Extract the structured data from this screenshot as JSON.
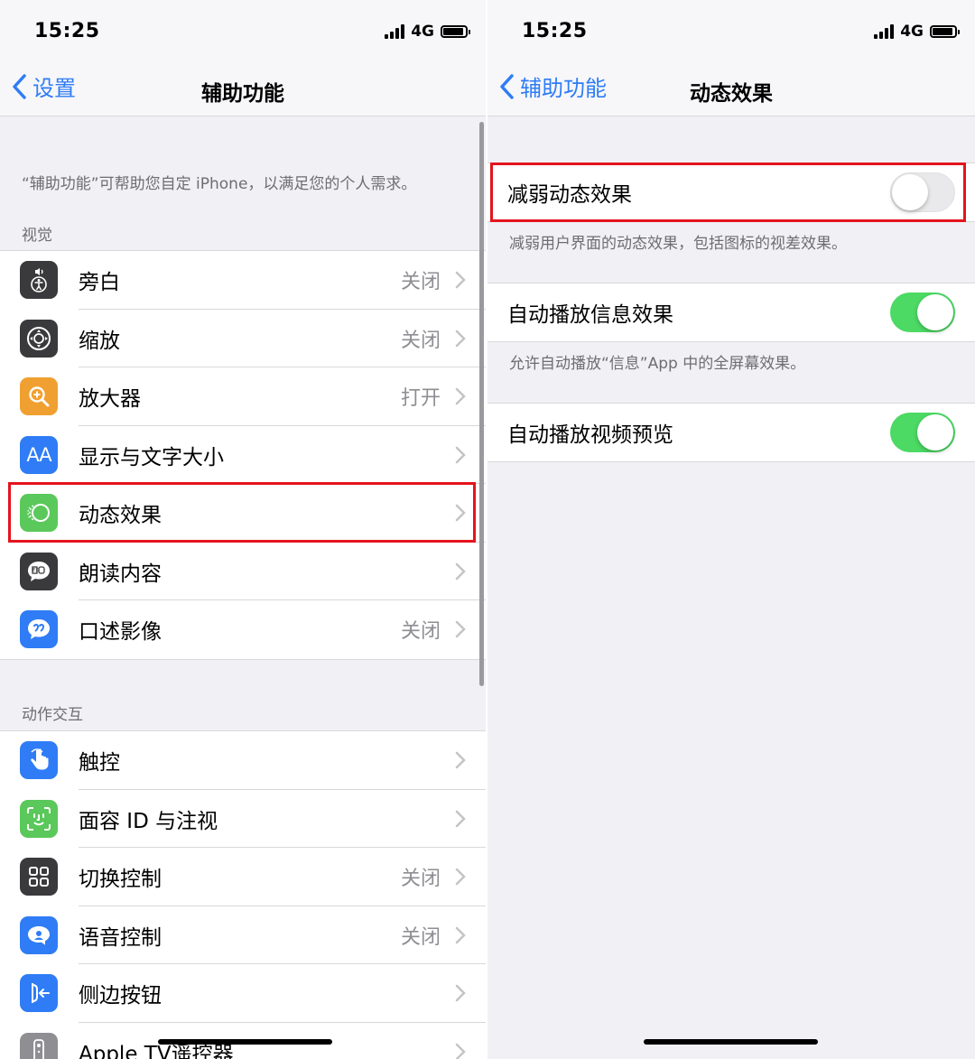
{
  "left": {
    "status": {
      "time": "15:25",
      "network": "4G"
    },
    "nav": {
      "back_label": "设置",
      "title": "辅助功能"
    },
    "intro": "“辅助功能”可帮助您自定 iPhone，以满足您的个人需求。",
    "sections": [
      {
        "header": "视觉",
        "rows": [
          {
            "label": "旁白",
            "value": "关闭",
            "icon": "voiceover-icon",
            "color": "#3a3a3c"
          },
          {
            "label": "缩放",
            "value": "关闭",
            "icon": "zoom-icon",
            "color": "#3a3a3c"
          },
          {
            "label": "放大器",
            "value": "打开",
            "icon": "magnifier-icon",
            "color": "#f0a030"
          },
          {
            "label": "显示与文字大小",
            "value": "",
            "icon": "text-size-icon",
            "color": "#2f7cf6"
          },
          {
            "label": "动态效果",
            "value": "",
            "icon": "motion-icon",
            "color": "#5ac85a"
          },
          {
            "label": "朗读内容",
            "value": "",
            "icon": "spoken-content-icon",
            "color": "#3a3a3c"
          },
          {
            "label": "口述影像",
            "value": "关闭",
            "icon": "audio-description-icon",
            "color": "#2f7cf6"
          }
        ]
      },
      {
        "header": "动作交互",
        "rows": [
          {
            "label": "触控",
            "value": "",
            "icon": "touch-icon",
            "color": "#2f7cf6"
          },
          {
            "label": "面容 ID 与注视",
            "value": "",
            "icon": "face-id-icon",
            "color": "#5ac85a"
          },
          {
            "label": "切换控制",
            "value": "关闭",
            "icon": "switch-control-icon",
            "color": "#3a3a3c"
          },
          {
            "label": "语音控制",
            "value": "关闭",
            "icon": "voice-control-icon",
            "color": "#2f7cf6"
          },
          {
            "label": "侧边按钮",
            "value": "",
            "icon": "side-button-icon",
            "color": "#2f7cf6"
          },
          {
            "label": "Apple TV遥控器",
            "value": "",
            "icon": "apple-tv-remote-icon",
            "color": "#8e8e93"
          }
        ]
      }
    ]
  },
  "right": {
    "status": {
      "time": "15:25",
      "network": "4G"
    },
    "nav": {
      "back_label": "辅助功能",
      "title": "动态效果"
    },
    "settings": [
      {
        "label": "减弱动态效果",
        "on": false,
        "footer": "减弱用户界面的动态效果，包括图标的视差效果。"
      },
      {
        "label": "自动播放信息效果",
        "on": true,
        "footer": "允许自动播放“信息”App 中的全屏幕效果。"
      },
      {
        "label": "自动播放视频预览",
        "on": true,
        "footer": ""
      }
    ]
  },
  "colors": {
    "accent": "#2f7cf6",
    "toggle_on": "#4cd964",
    "highlight": "#e4141e"
  }
}
